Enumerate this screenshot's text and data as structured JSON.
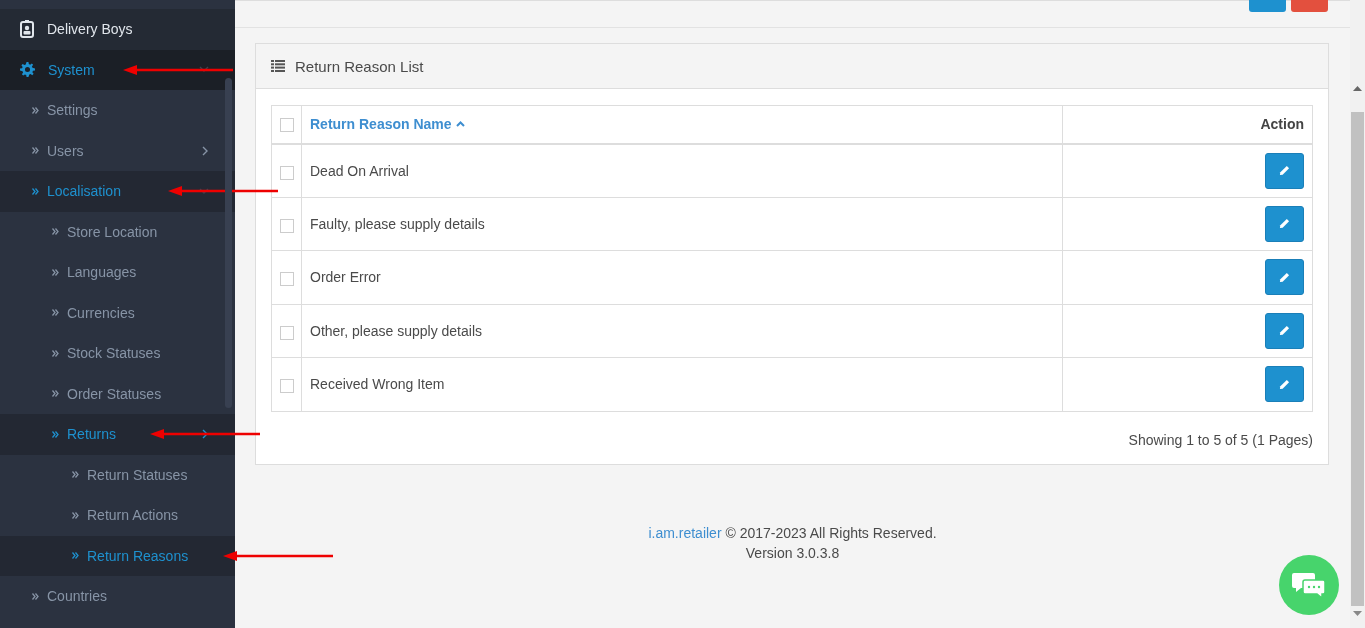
{
  "sidebar": {
    "items": [
      {
        "label": "Delivery Boys",
        "selected": false
      },
      {
        "label": "System",
        "selected": true,
        "expanded": true,
        "arrow": true,
        "children": [
          {
            "label": "Settings",
            "selected": false
          },
          {
            "label": "Users",
            "selected": false,
            "expanded": false
          },
          {
            "label": "Localisation",
            "selected": true,
            "expanded": true,
            "arrow": true,
            "children": [
              {
                "label": "Store Location",
                "selected": false
              },
              {
                "label": "Languages",
                "selected": false
              },
              {
                "label": "Currencies",
                "selected": false
              },
              {
                "label": "Stock Statuses",
                "selected": false
              },
              {
                "label": "Order Statuses",
                "selected": false
              },
              {
                "label": "Returns",
                "selected": true,
                "expanded": false,
                "arrow": true,
                "children": [
                  {
                    "label": "Return Statuses",
                    "selected": false
                  },
                  {
                    "label": "Return Actions",
                    "selected": false
                  },
                  {
                    "label": "Return Reasons",
                    "selected": true,
                    "arrow": true
                  }
                ]
              }
            ]
          },
          {
            "label": "Countries",
            "selected": false
          }
        ]
      }
    ]
  },
  "panel": {
    "title": "Return Reason List",
    "table": {
      "all_checked": false,
      "columns": [
        {
          "label": "Return Reason Name",
          "sort_ascending": true
        },
        {
          "label": "Action"
        }
      ],
      "rows": [
        {
          "name": "Dead On Arrival",
          "checked": false
        },
        {
          "name": "Faulty, please supply details",
          "checked": false
        },
        {
          "name": "Order Error",
          "checked": false
        },
        {
          "name": "Other, please supply details",
          "checked": false
        },
        {
          "name": "Received Wrong Item",
          "checked": false
        }
      ]
    },
    "pagination": "Showing 1 to 5 of 5 (1 Pages)"
  },
  "footer": {
    "link": "i.am.retailer",
    "text": "© 2017-2023 All Rights Reserved.",
    "version": "Version 3.0.3.8"
  }
}
